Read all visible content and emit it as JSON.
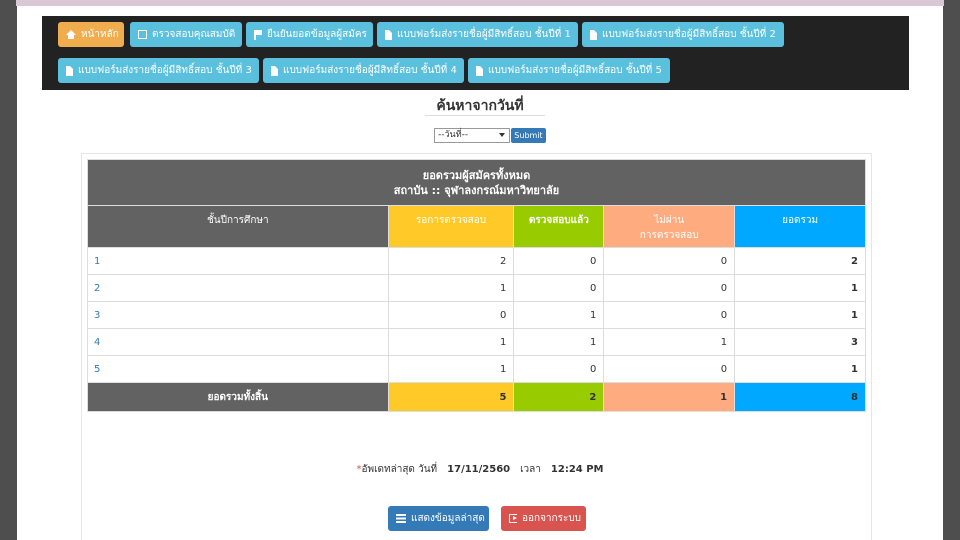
{
  "nav": {
    "home": "หน้าหลัก",
    "check_qualification": "ตรวจสอบคุณสมบัติ",
    "confirm_applicants": "ยืนยันยอดข้อมูลผู้สมัคร",
    "form1": "แบบฟอร์มส่งรายชื่อผู้มีสิทธิ์สอบ ชั้นปีที่ 1",
    "form2": "แบบฟอร์มส่งรายชื่อผู้มีสิทธิ์สอบ ชั้นปีที่ 2",
    "form3": "แบบฟอร์มส่งรายชื่อผู้มีสิทธิ์สอบ ชั้นปีที่ 3",
    "form4": "แบบฟอร์มส่งรายชื่อผู้มีสิทธิ์สอบ ชั้นปีที่ 4",
    "form5": "แบบฟอร์มส่งรายชื่อผู้มีสิทธิ์สอบ ชั้นปีที่ 5"
  },
  "search": {
    "title": "ค้นหาจากวันที่",
    "select_value": "--วันที่--",
    "submit": "Submit"
  },
  "table": {
    "title_line1": "ยอดรวมผู้สมัครทั้งหมด",
    "title_line2": "สถาบัน :: จุฬาลงกรณ์มหาวิทยาลัย",
    "headers": {
      "level": "ชั้นปีการศึกษา",
      "pending": "รอการตรวจสอบ",
      "checked": "ตรวจสอบแล้ว",
      "failed_line1": "ไม่ผ่าน",
      "failed_line2": "การตรวจสอบ",
      "total": "ยอดรวม"
    },
    "rows": [
      {
        "level": "1",
        "pending": "2",
        "checked": "0",
        "failed": "0",
        "total": "2"
      },
      {
        "level": "2",
        "pending": "1",
        "checked": "0",
        "failed": "0",
        "total": "1"
      },
      {
        "level": "3",
        "pending": "0",
        "checked": "1",
        "failed": "0",
        "total": "1"
      },
      {
        "level": "4",
        "pending": "1",
        "checked": "1",
        "failed": "1",
        "total": "3"
      },
      {
        "level": "5",
        "pending": "1",
        "checked": "0",
        "failed": "0",
        "total": "1"
      }
    ],
    "footer": {
      "label": "ยอดรวมทั้งสิ้น",
      "pending": "5",
      "checked": "2",
      "failed": "1",
      "total": "8"
    }
  },
  "update": {
    "star": "*",
    "label": "อัพเดทล่าสุด วันที่",
    "date": "17/11/2560",
    "time_label": "เวลา",
    "time": "12:24 PM"
  },
  "actions": {
    "show_latest": "แสดงข้อมูลล่าสุด",
    "logout": "ออกจากระบบ"
  },
  "colors": {
    "header_gray": "#626262",
    "pending_yellow": "#ffca28",
    "checked_green": "#99cc00",
    "failed_orange": "#ffab80",
    "total_blue": "#00a8ff"
  }
}
